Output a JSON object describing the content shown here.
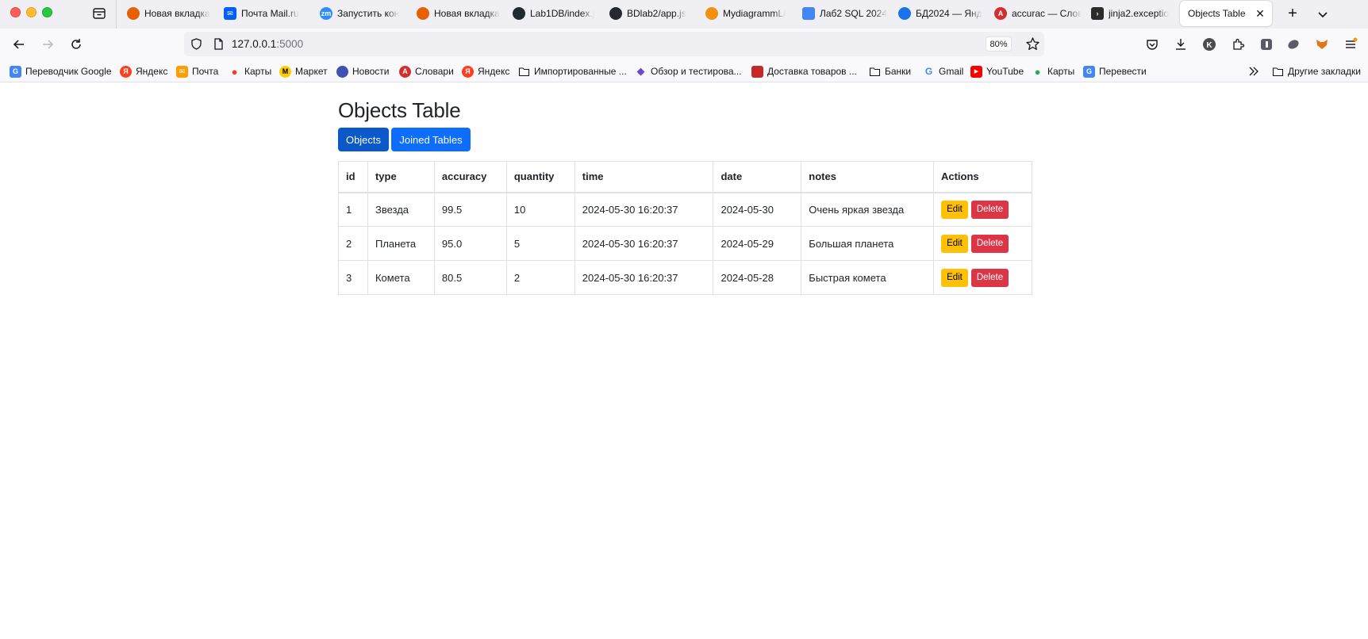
{
  "browser": {
    "tabs": [
      {
        "title": "Новая вкладка",
        "icon": "firefox-icon",
        "color": "#e66000"
      },
      {
        "title": "Почта Mail.ru",
        "icon": "mail-icon",
        "color": "#005ff9"
      },
      {
        "title": "Запустить кон",
        "icon": "zoom-icon",
        "color": "#2d8cff"
      },
      {
        "title": "Новая вкладка",
        "icon": "firefox-icon",
        "color": "#e66000"
      },
      {
        "title": "Lab1DB/index.j",
        "icon": "github-icon",
        "color": "#24292f"
      },
      {
        "title": "BDlab2/app.js",
        "icon": "github-icon",
        "color": "#24292f"
      },
      {
        "title": "MydiagrammL/",
        "icon": "diagram-icon",
        "color": "#f29111"
      },
      {
        "title": "Лаб2 SQL 2024",
        "icon": "docs-icon",
        "color": "#4285f4"
      },
      {
        "title": "БД2024 — Янд",
        "icon": "yandex-disk-icon",
        "color": "#1a73e8"
      },
      {
        "title": "accurac — Слов",
        "icon": "dictionary-icon",
        "color": "#d32f2f"
      },
      {
        "title": "jinja2.exceptio",
        "icon": "terminal-icon",
        "color": "#2b2b2b"
      },
      {
        "title": "Objects Table",
        "icon": "none",
        "color": "#ffffff"
      }
    ],
    "url_host": "127.0.0.1",
    "url_port": ":5000",
    "zoom": "80%",
    "bookmarks": [
      {
        "label": "Переводчик Google",
        "icon": "translate-icon",
        "color": "#4285f4"
      },
      {
        "label": "Яндекс",
        "icon": "yandex-icon",
        "color": "#fc3f1d"
      },
      {
        "label": "Почта",
        "icon": "mail-icon",
        "color": "#ff9e00"
      },
      {
        "label": "Карты",
        "icon": "map-pin-icon",
        "color": "#ff3333"
      },
      {
        "label": "Маркет",
        "icon": "market-icon",
        "color": "#ffcc00"
      },
      {
        "label": "Новости",
        "icon": "news-icon",
        "color": "#3f51b5"
      },
      {
        "label": "Словари",
        "icon": "dictionary-icon",
        "color": "#d32f2f"
      },
      {
        "label": "Яндекс",
        "icon": "yandex-icon",
        "color": "#fc3f1d"
      },
      {
        "label": "Импортированные ...",
        "icon": "folder-icon",
        "color": "#15141a"
      },
      {
        "label": "Обзор и тестирова...",
        "icon": "diamond-icon",
        "color": "#6a4bc4"
      },
      {
        "label": "Доставка товаров ...",
        "icon": "store-icon",
        "color": "#c62828"
      },
      {
        "label": "Банки",
        "icon": "folder-icon",
        "color": "#15141a"
      },
      {
        "label": "Gmail",
        "icon": "google-icon",
        "color": "#4285f4"
      },
      {
        "label": "YouTube",
        "icon": "youtube-icon",
        "color": "#ff0000"
      },
      {
        "label": "Карты",
        "icon": "google-maps-icon",
        "color": "#34a853"
      },
      {
        "label": "Перевести",
        "icon": "translate-icon",
        "color": "#4285f4"
      }
    ],
    "other_bookmarks": "Другие закладки"
  },
  "page": {
    "title": "Objects Table",
    "nav_objects": "Objects",
    "nav_joined": "Joined Tables",
    "table": {
      "headers": [
        "id",
        "type",
        "accuracy",
        "quantity",
        "time",
        "date",
        "notes",
        "Actions"
      ],
      "rows": [
        {
          "id": "1",
          "type": "Звезда",
          "accuracy": "99.5",
          "quantity": "10",
          "time": "2024-05-30 16:20:37",
          "date": "2024-05-30",
          "notes": "Очень яркая звезда"
        },
        {
          "id": "2",
          "type": "Планета",
          "accuracy": "95.0",
          "quantity": "5",
          "time": "2024-05-30 16:20:37",
          "date": "2024-05-29",
          "notes": "Большая планета"
        },
        {
          "id": "3",
          "type": "Комета",
          "accuracy": "80.5",
          "quantity": "2",
          "time": "2024-05-30 16:20:37",
          "date": "2024-05-28",
          "notes": "Быстрая комета"
        }
      ],
      "edit_label": "Edit",
      "delete_label": "Delete"
    }
  }
}
